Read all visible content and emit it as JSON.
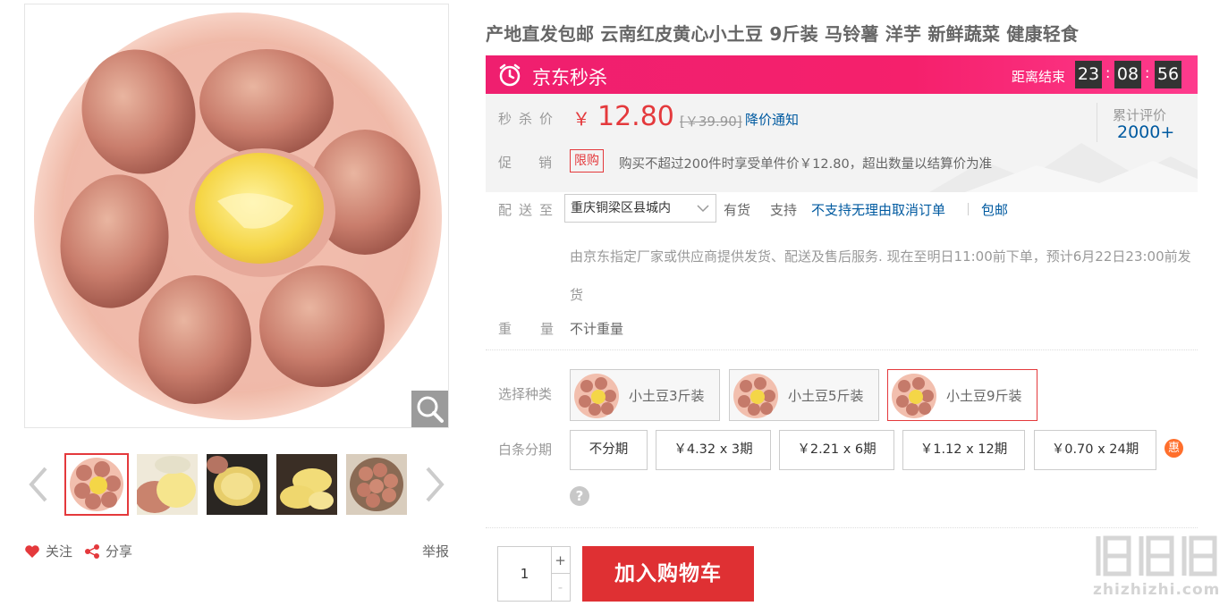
{
  "product": {
    "title": "产地直发包邮 云南红皮黄心小土豆 9斤装 马铃薯 洋芋 新鲜蔬菜 健康轻食"
  },
  "gallery": {
    "thumbnails": [
      "thumb-1",
      "thumb-2",
      "thumb-3",
      "thumb-4",
      "thumb-5"
    ],
    "active_index": 0
  },
  "actions": {
    "follow": "关注",
    "share": "分享",
    "report": "举报"
  },
  "seckill": {
    "label": "京东秒杀",
    "ends_in_label": "距离结束",
    "hours": "23",
    "minutes": "08",
    "seconds": "56",
    "colon": ":"
  },
  "price": {
    "label": "秒杀价",
    "currency": "￥",
    "current": "12.80",
    "original": "[￥39.90]",
    "notify_label": "降价通知",
    "review_label": "累计评价",
    "review_count": "2000+"
  },
  "promotion": {
    "label": "促销",
    "tag": "限购",
    "text": "购买不超过200件时享受单件价￥12.80，超出数量以结算价为准"
  },
  "delivery": {
    "label": "配送至",
    "region": "重庆铜梁区县城内",
    "stock": "有货",
    "support": "支持",
    "support_link": "不支持无理由取消订单",
    "free_shipping": "包邮",
    "note": "由京东指定厂家或供应商提供发货、配送及售后服务. 现在至明日11:00前下单，预计6月22日23:00前发货"
  },
  "weight": {
    "label": "重量",
    "value": "不计重量"
  },
  "variants": {
    "label": "选择种类",
    "items": [
      "小土豆3斤装",
      "小土豆5斤装",
      "小土豆9斤装"
    ],
    "selected_index": 2
  },
  "installment": {
    "label": "白条分期",
    "options": [
      "不分期",
      "￥4.32 x 3期",
      "￥2.21 x 6期",
      "￥1.12 x 12期",
      "￥0.70 x 24期"
    ],
    "badge": "惠",
    "help": "?"
  },
  "cart": {
    "quantity": "1",
    "plus": "+",
    "minus": "-",
    "button_label": "加入购物车"
  },
  "watermark": {
    "text": "zhizhizhi.com"
  },
  "colors": {
    "accent_red": "#e4393c",
    "seckill_pink": "#f5206c",
    "link_blue": "#005aa0",
    "orange_badge": "#ff6f2c"
  }
}
